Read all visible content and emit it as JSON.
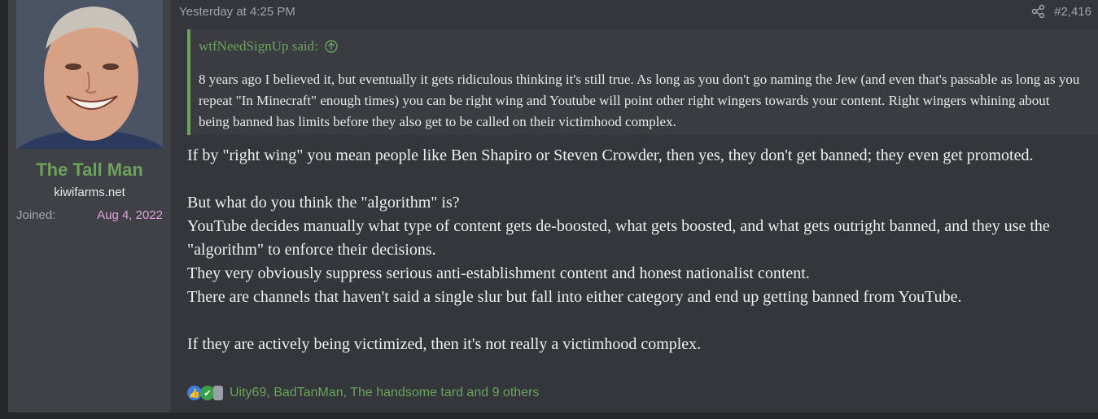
{
  "user": {
    "name": "The Tall Man",
    "title": "kiwifarms.net",
    "joined_label": "Joined:",
    "joined_value": "Aug 4, 2022",
    "avatar": "avatar-photo"
  },
  "post": {
    "date": "Yesterday at 4:25 PM",
    "number": "#2,416",
    "share_icon": "share-icon"
  },
  "quote": {
    "author": "wtfNeedSignUp said:",
    "jump_icon": "arrow-up-circle-icon",
    "text": "8 years ago I believed it, but eventually it gets ridiculous thinking it's still true. As long as you don't go naming the Jew (and even that's passable as long as you repeat \"In Minecraft\" enough times) you can be right wing and Youtube will point other right wingers towards your content. Right wingers whining about being banned has limits before they also get to be called on their victimhood complex."
  },
  "message": {
    "p1": "If by \"right wing\" you mean people like Ben Shapiro or Steven Crowder, then yes, they don't get banned; they even get promoted.",
    "p2": "But what do you think the \"algorithm\" is?",
    "p3": "YouTube decides manually what type of content gets de-boosted, what gets boosted, and what gets outright banned, and they use the \"algorithm\" to enforce their decisions.",
    "p4": "They very obviously suppress serious anti-establishment content and honest nationalist content.",
    "p5": "There are channels that haven't said a single slur but fall into either category and end up getting banned from YouTube.",
    "p6": "If they are actively being victimized, then it's not really a victimhood complex."
  },
  "reactions": {
    "icons": [
      "like-icon",
      "check-icon",
      "trash-icon"
    ],
    "text": "Uity69, BadTanMan, The handsome tard and 9 others"
  },
  "colors": {
    "accent_green": "#6ba35a",
    "joined_date": "#e0a0e0",
    "background": "#34363b",
    "sidebar": "#3f4147"
  }
}
